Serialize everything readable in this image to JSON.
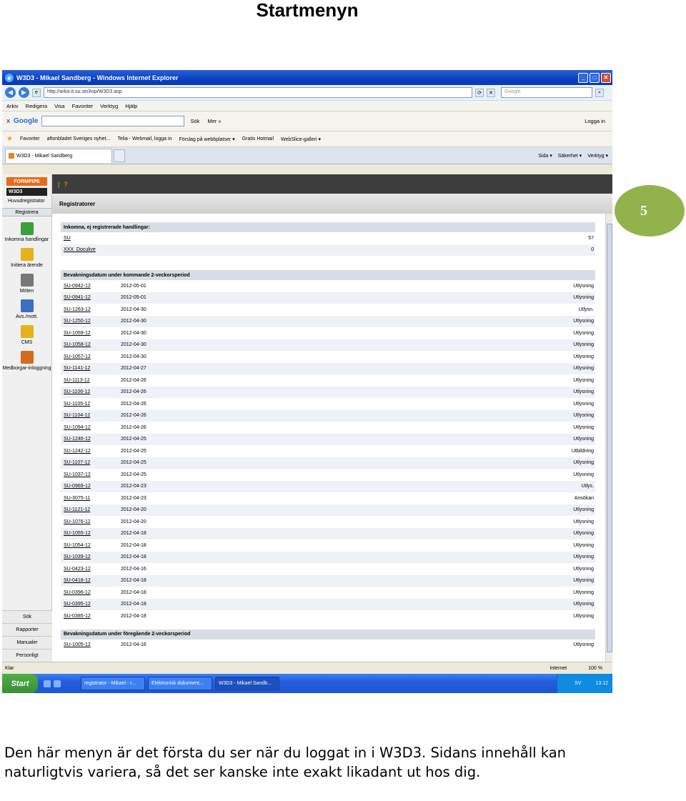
{
  "doc": {
    "title": "Startmenyn",
    "page_number": "5",
    "caption": "Den här menyn är det första du ser när du loggat in i W3D3. Sidans innehåll kan naturligtvis variera, så det ser kanske inte exakt likadant ut hos dig."
  },
  "browser": {
    "window_title": "W3D3 - Mikael Sandberg - Windows Internet Explorer",
    "url": "http://arkiv.it.su.se/Asp/W3D3.asp",
    "search_placeholder": "Google",
    "menu": [
      "Arkiv",
      "Redigera",
      "Visa",
      "Favoriter",
      "Verktyg",
      "Hjälp"
    ],
    "google_bar": {
      "close": "X",
      "logo": "Google",
      "search": "Sök",
      "more": "Mer »",
      "login": "Logga in"
    },
    "favorites": [
      "Favoriter",
      "aftonbladet Sveriges nyhet...",
      "Telia - Webmail, logga in",
      "Förslag på webbplatser ▾",
      "Gratis Hotmail",
      "WebSlice-galleri ▾"
    ],
    "tab_label": "W3D3 - Mikael Sandberg",
    "commands": [
      "Sida ▾",
      "Säkerhet ▾",
      "Verktyg ▾"
    ],
    "status_left": "Klar",
    "status_zone": "Internet",
    "zoom": "100 %"
  },
  "app": {
    "logo_top": "FORMPIPE",
    "logo_sub": "W3D3",
    "register_label": "Huvudregistrator",
    "register_tab": "Registrera",
    "side_items": [
      {
        "label": "Inkomna handlingar",
        "color": "#3aa03a"
      },
      {
        "label": "Initiera ärende",
        "color": "#e4b21c"
      },
      {
        "label": "Möten",
        "color": "#777777"
      },
      {
        "label": "Avs./mott.",
        "color": "#3d6fc0"
      },
      {
        "label": "CMS",
        "color": "#e4b21c"
      },
      {
        "label": "Medborgar-inloggning",
        "color": "#d46b1c"
      }
    ],
    "bottom_items": [
      "Sök",
      "Rapporter",
      "Manualer",
      "Personligt"
    ],
    "toolbar_help": "?",
    "page_header": "Registratorer",
    "incoming": {
      "heading": "Inkomna, ej registrerade handlingar:",
      "rows": [
        {
          "name": "SU",
          "count": "57"
        },
        {
          "name": "XXX_Doculive",
          "count": "0"
        }
      ]
    },
    "upcoming": {
      "heading": "Bevakningsdatum under kommande 2-veckorsperiod",
      "rows": [
        {
          "id": "SU-0942-12",
          "date": "2012-05-01",
          "type": "Utlysning"
        },
        {
          "id": "SU-0941-12",
          "date": "2012-05-01",
          "type": "Utlysning"
        },
        {
          "id": "SU-1263-12",
          "date": "2012-04-30",
          "type": "Utlysn."
        },
        {
          "id": "SU-1250-12",
          "date": "2012-04-30",
          "type": "Utlysning"
        },
        {
          "id": "SU-1059-12",
          "date": "2012-04-30",
          "type": "Utlysning"
        },
        {
          "id": "SU-1058-12",
          "date": "2012-04-30",
          "type": "Utlysning"
        },
        {
          "id": "SU-1057-12",
          "date": "2012-04-30",
          "type": "Utlysning"
        },
        {
          "id": "SU-1141-12",
          "date": "2012-04-27",
          "type": "Utlysning"
        },
        {
          "id": "SU-1113-12",
          "date": "2012-04-26",
          "type": "Utlysning"
        },
        {
          "id": "SU-1106-12",
          "date": "2012-04-26",
          "type": "Utlysning"
        },
        {
          "id": "SU-1105-12",
          "date": "2012-04-26",
          "type": "Utlysning"
        },
        {
          "id": "SU-1104-12",
          "date": "2012-04-26",
          "type": "Utlysning"
        },
        {
          "id": "SU-1094-12",
          "date": "2012-04-26",
          "type": "Utlysning"
        },
        {
          "id": "SU-1246-12",
          "date": "2012-04-25",
          "type": "Utlysning"
        },
        {
          "id": "SU-1242-12",
          "date": "2012-04-25",
          "type": "Utbildning"
        },
        {
          "id": "SU-1107-12",
          "date": "2012-04-25",
          "type": "Utlysning"
        },
        {
          "id": "SU-1037-12",
          "date": "2012-04-25",
          "type": "Utlysning"
        },
        {
          "id": "SU-0969-12",
          "date": "2012-04-23",
          "type": "Utlys."
        },
        {
          "id": "SU-3075-11",
          "date": "2012-04-23",
          "type": "Ansökan"
        },
        {
          "id": "SU-1121-12",
          "date": "2012-04-20",
          "type": "Utlysning"
        },
        {
          "id": "SU-1076-12",
          "date": "2012-04-20",
          "type": "Utlysning"
        },
        {
          "id": "SU-1055-12",
          "date": "2012-04-18",
          "type": "Utlysning"
        },
        {
          "id": "SU-1054-12",
          "date": "2012-04-18",
          "type": "Utlysning"
        },
        {
          "id": "SU-1039-12",
          "date": "2012-04-18",
          "type": "Utlysning"
        },
        {
          "id": "SU-0423-12",
          "date": "2012-04-16",
          "type": "Utlysning"
        },
        {
          "id": "SU-0418-12",
          "date": "2012-04-18",
          "type": "Utlysning"
        },
        {
          "id": "SU-0396-12",
          "date": "2012-04-18",
          "type": "Utlysning"
        },
        {
          "id": "SU-0395-12",
          "date": "2012-04-18",
          "type": "Utlysning"
        },
        {
          "id": "SU-0385-12",
          "date": "2012-04-18",
          "type": "Utlysning"
        }
      ]
    },
    "previous": {
      "heading": "Bevakningsdatum under föregående 2-veckorsperiod",
      "rows": [
        {
          "id": "SU-1005-12",
          "date": "2012-04-16",
          "type": "Utlysning"
        }
      ]
    }
  },
  "taskbar": {
    "start": "Start",
    "tasks": [
      "registrator - Mikael - r...",
      "Elektronisk dokument...",
      "W3D3 - Mikael Sandb..."
    ],
    "lang": "SV",
    "clock": "13:12"
  }
}
